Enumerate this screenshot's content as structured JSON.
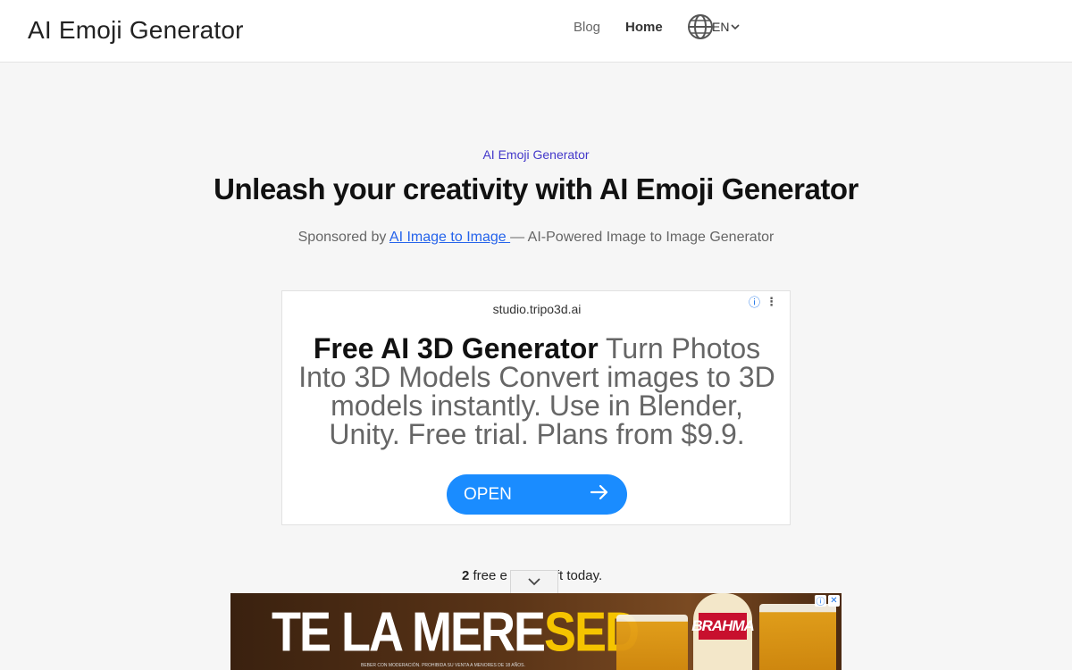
{
  "header": {
    "brand": "AI Emoji Generator",
    "nav": {
      "blog": "Blog",
      "home": "Home"
    },
    "language": "EN"
  },
  "hero": {
    "eyebrow": "AI Emoji Generator",
    "title": "Unleash your creativity with AI Emoji Generator",
    "sponsor_prefix": "Sponsored by ",
    "sponsor_link": "AI Image to Image ",
    "sponsor_suffix": "— AI-Powered Image to Image Generator"
  },
  "ad": {
    "domain": "studio.tripo3d.ai",
    "headline": "Free AI 3D Generator",
    "body": " Turn Photos Into 3D Models Convert images to 3D models instantly. Use in Blender, Unity. Free trial. Plans from $9.9.",
    "cta": "OPEN",
    "info_icon": "ⓘ",
    "menu_icon": "⋮"
  },
  "usage": {
    "count": "2",
    "text_start": " free e",
    "text_end": "ft today."
  },
  "banner": {
    "headline_white": "TE LA MERE",
    "headline_accent": "SED",
    "fine_print": "BEBER CON MODERACIÓN. PROHIBIDA SU VENTA A MENORES DE 18 AÑOS.",
    "bottle_brand": "BRAHMA",
    "info_icon": "ⓘ",
    "close_icon": "✕"
  },
  "colors": {
    "accent": "#4338ca",
    "link": "#2563eb",
    "cta": "#1a8cff"
  }
}
